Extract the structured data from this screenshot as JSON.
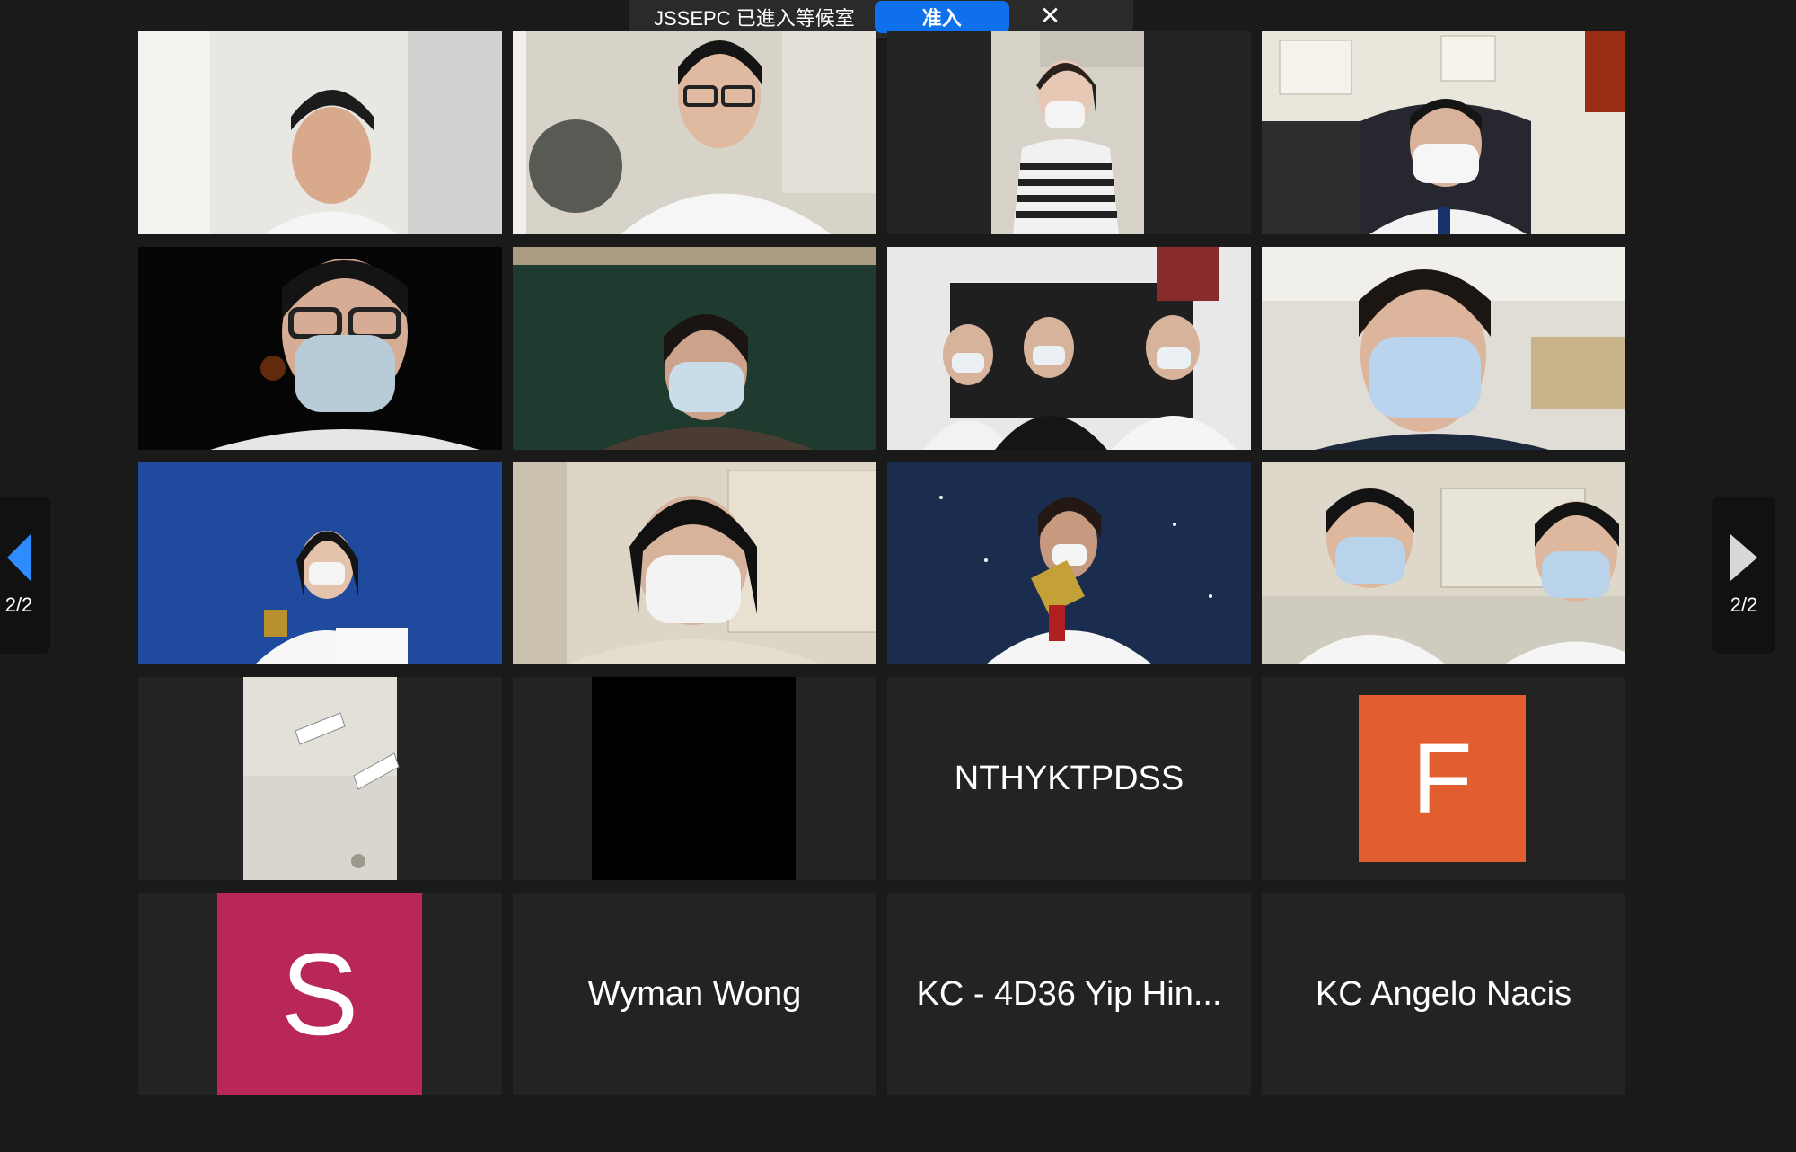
{
  "notification": {
    "message": "JSSEPC 已進入等候室",
    "admit_label": "准入",
    "close_icon": "close-icon"
  },
  "pagination": {
    "prev_label": "2/2",
    "next_label": "2/2"
  },
  "tiles": {
    "nthyktpdss": "NTHYKTPDSS",
    "f_initial": "F",
    "s_initial": "S",
    "wyman": "Wyman Wong",
    "kc_yip": "KC - 4D36 Yip Hin...",
    "kc_angelo": "KC Angelo Nacis"
  },
  "colors": {
    "accent": "#0e71eb",
    "avatar_f": "#e25e31",
    "avatar_s": "#b9275a"
  }
}
